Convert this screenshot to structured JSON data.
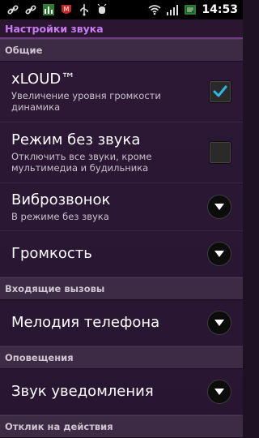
{
  "statusbar": {
    "time": "14:53",
    "icons": [
      "link-icon",
      "link-icon",
      "equalizer-icon",
      "mcafee-icon",
      "usb-icon",
      "debug-icon",
      "wifi-icon",
      "signal-icon",
      "battery-icon"
    ]
  },
  "appbar": {
    "title": "Настройки звука"
  },
  "sections": {
    "general": "Общие",
    "incoming": "Входящие вызовы",
    "notifications": "Оповещения",
    "feedback": "Отклик на действия"
  },
  "items": {
    "xloud": {
      "title": "xLOUD™",
      "subtitle": "Увеличение уровня громкости динамика",
      "checked": true
    },
    "silent": {
      "title": "Режим без звука",
      "subtitle": "Отключить все звуки, кроме мультимедиа и будильника",
      "checked": false
    },
    "vibrate": {
      "title": "Виброзвонок",
      "subtitle": "В режиме без звука"
    },
    "volume": {
      "title": "Громкость"
    },
    "ringtone": {
      "title": "Мелодия телефона"
    },
    "notification_sound": {
      "title": "Звук уведомления"
    }
  },
  "colors": {
    "accent": "#c77cf0",
    "check": "#33b5e5"
  }
}
